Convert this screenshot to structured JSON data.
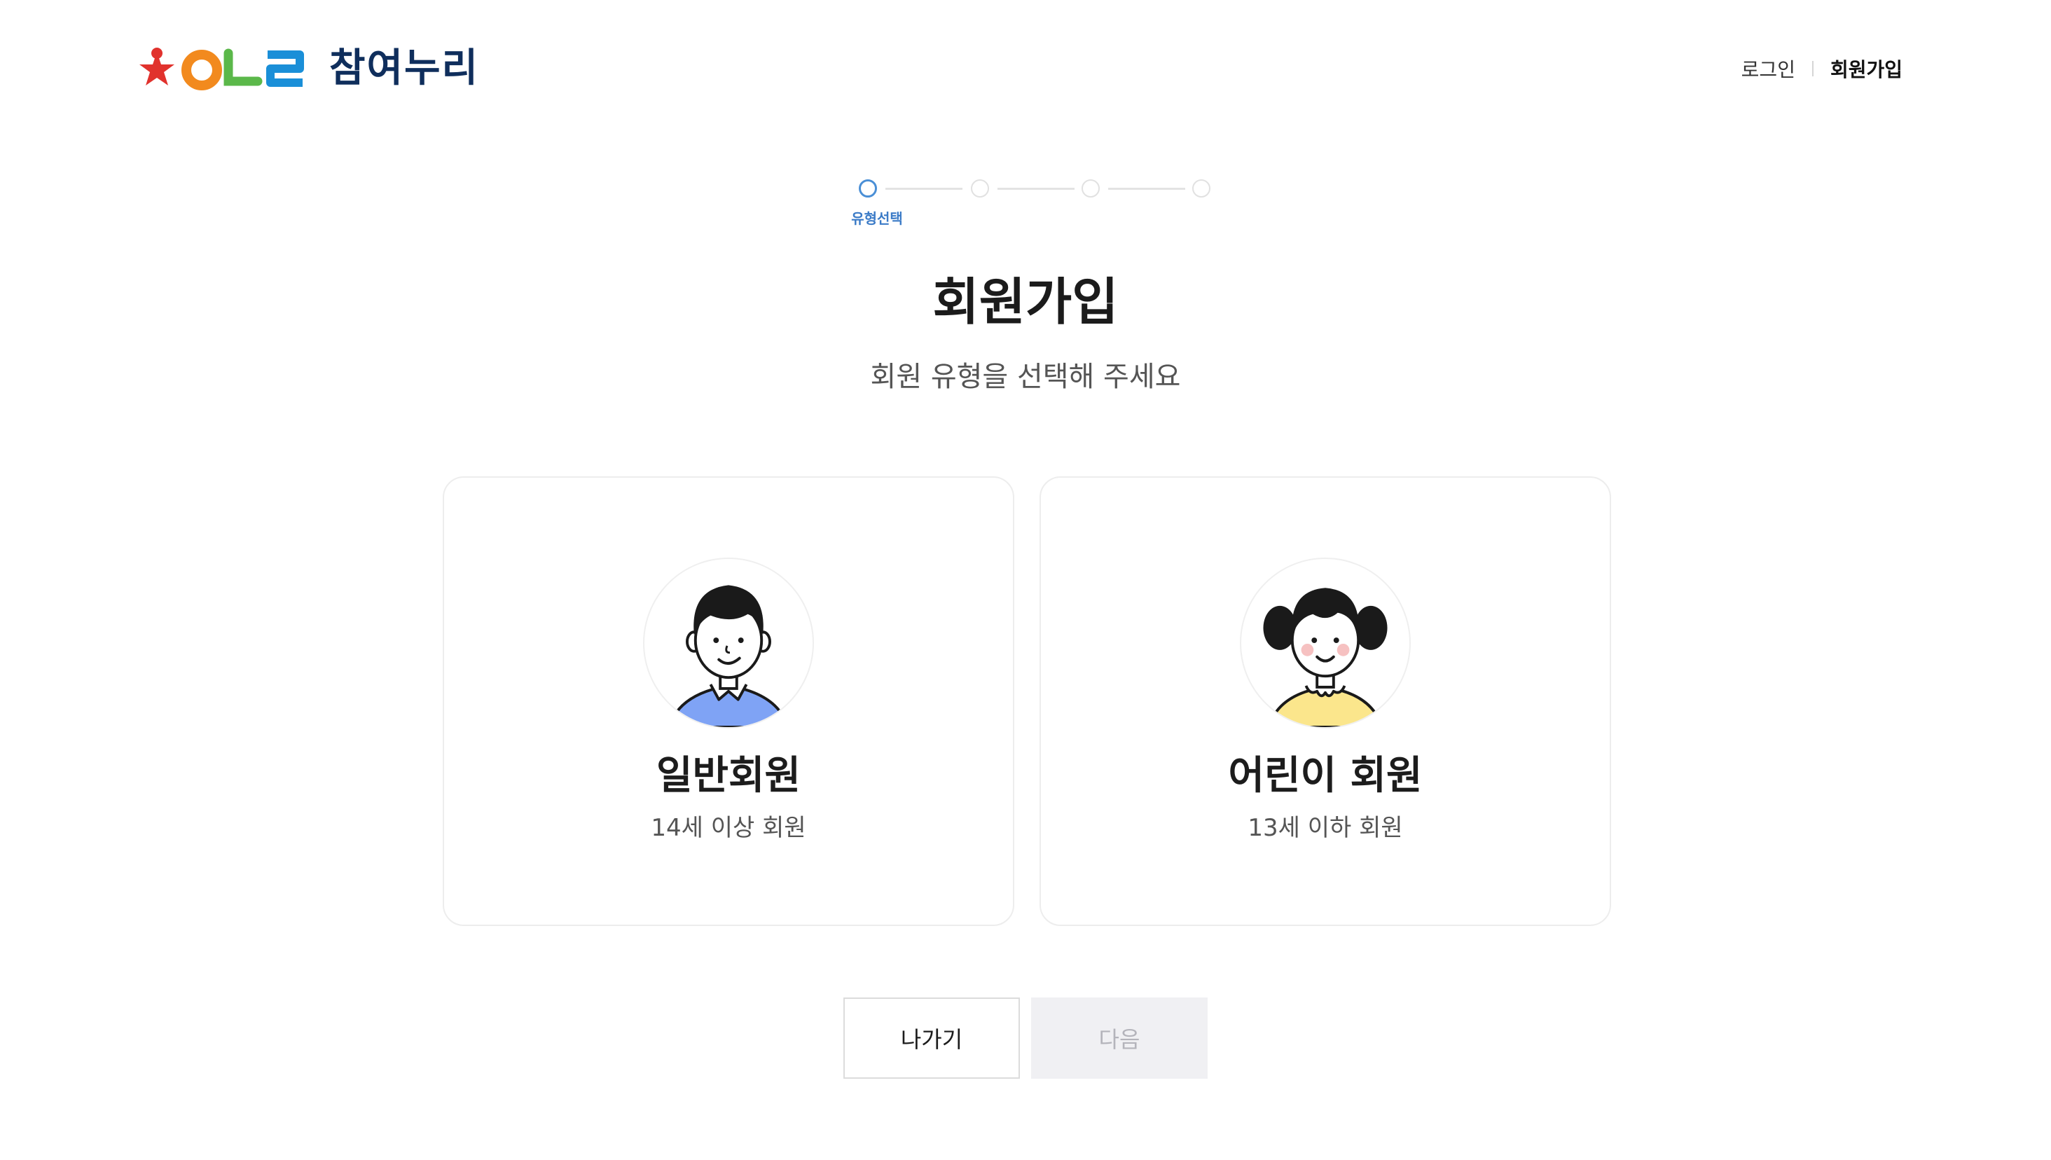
{
  "header": {
    "logo_text": "참여누리",
    "logo_mark_label": "ㅇㄴㄹ",
    "nav": {
      "login": "로그인",
      "signup": "회원가입"
    }
  },
  "stepper": {
    "current_step": 1,
    "total_steps": 4,
    "active_label": "유형선택",
    "colors": {
      "active": "#4a8fd6",
      "inactive": "#e1e1e1"
    }
  },
  "main": {
    "title": "회원가입",
    "subtitle": "회원 유형을 선택해 주세요"
  },
  "member_types": [
    {
      "title": "일반회원",
      "description": "14세 이상 회원",
      "avatar_icon": "boy-avatar-icon",
      "shirt_color": "#7fa3f5"
    },
    {
      "title": "어린이 회원",
      "description": "13세 이하 회원",
      "avatar_icon": "girl-avatar-icon",
      "shirt_color": "#fbe68c"
    }
  ],
  "buttons": {
    "exit": "나가기",
    "next": "다음",
    "next_disabled": true
  }
}
